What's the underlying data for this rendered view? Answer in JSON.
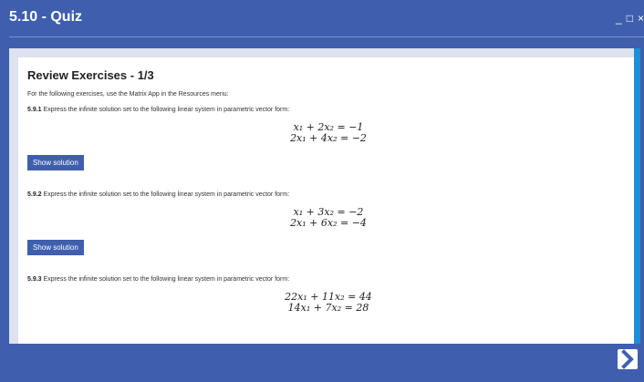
{
  "window": {
    "title": "5.10 - Quiz",
    "controls": [
      "_",
      "□",
      "×"
    ]
  },
  "content": {
    "heading": "Review Exercises - 1/3",
    "intro": "For the following exercises, use the Matrix App in the Resources menu:",
    "exercises": [
      {
        "number": "5.9.1",
        "text": "Express the infinite solution set to the following linear system in parametric vector form:",
        "equations": [
          "x₁ + 2x₂ = −1",
          "2x₁ + 4x₂ = −2"
        ],
        "button": "Show solution"
      },
      {
        "number": "5.9.2",
        "text": "Express the infinite solution set to the following linear system in parametric vector form:",
        "equations": [
          "x₁ + 3x₂ = −2",
          "2x₁ + 6x₂ = −4"
        ],
        "button": "Show solution"
      },
      {
        "number": "5.9.3",
        "text": "Express the infinite solution set to the following linear system in parametric vector form:",
        "equations": [
          "22x₁ + 11x₂ = 44",
          "14x₁ + 7x₂ = 28"
        ]
      }
    ]
  },
  "footer": {
    "next_icon": "chevron-right-icon"
  },
  "colors": {
    "brand": "#3f5fae",
    "accent": "#1d8fd6"
  }
}
